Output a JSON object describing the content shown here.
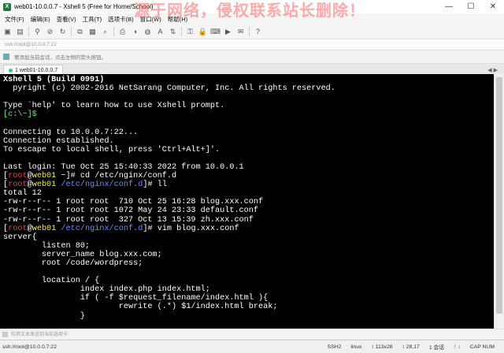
{
  "window": {
    "title": "web01-10.0.0.7 - Xshell 5 (Free for Home/School)",
    "watermark": "源于网络，侵权联系站长删除！",
    "controls": [
      "—",
      "☐",
      "✕"
    ]
  },
  "menu": [
    "文件(F)",
    "编辑(E)",
    "查看(V)",
    "工具(T)",
    "选项卡(B)",
    "窗口(W)",
    "帮助(H)"
  ],
  "address": {
    "value": "ssh://root@10.0.0.7:22"
  },
  "hint": "要添加当前会话，点击左侧的箭头按钮。",
  "tabs": [
    {
      "label": "1 web01-10.0.0.7"
    }
  ],
  "tab_nav": "◀ ▶",
  "terminal": {
    "lines": [
      [
        {
          "t": "Xshell 5 (Build 0991)",
          "c": "bold"
        }
      ],
      [
        {
          "t": "  pyright (c) 2002-2016 NetSarang Computer, Inc. All rights reserved."
        }
      ],
      [
        {
          "t": ""
        }
      ],
      [
        {
          "t": "Type `help' to learn how to use Xshell prompt."
        }
      ],
      [
        {
          "t": "[c:\\~]$",
          "c": "c-green"
        }
      ],
      [
        {
          "t": ""
        }
      ],
      [
        {
          "t": "Connecting to 10.0.0.7:22..."
        }
      ],
      [
        {
          "t": "Connection established."
        }
      ],
      [
        {
          "t": "To escape to local shell, press 'Ctrl+Alt+]'."
        }
      ],
      [
        {
          "t": ""
        }
      ],
      [
        {
          "t": "Last login: Tue Oct 25 15:40:33 2022 from 10.0.0.1"
        }
      ],
      [
        {
          "t": "["
        },
        {
          "t": "root",
          "c": "c-red"
        },
        {
          "t": "@"
        },
        {
          "t": "web01",
          "c": "c-yellow"
        },
        {
          "t": " ~]# cd /etc/nginx/conf.d"
        }
      ],
      [
        {
          "t": "["
        },
        {
          "t": "root",
          "c": "c-red"
        },
        {
          "t": "@"
        },
        {
          "t": "web01",
          "c": "c-yellow"
        },
        {
          "t": " "
        },
        {
          "t": "/etc/nginx/conf.d",
          "c": "c-blue"
        },
        {
          "t": "]# ll"
        }
      ],
      [
        {
          "t": "total 12"
        }
      ],
      [
        {
          "t": "-rw-r--r-- 1 root root  710 Oct 25 16:28 blog.xxx.conf"
        }
      ],
      [
        {
          "t": "-rw-r--r-- 1 root root 1072 May 24 23:33 default.conf"
        }
      ],
      [
        {
          "t": "-rw-r--r-- 1 root root  327 Oct 13 15:39 zh.xxx.conf"
        }
      ],
      [
        {
          "t": "["
        },
        {
          "t": "root",
          "c": "c-red"
        },
        {
          "t": "@"
        },
        {
          "t": "web01",
          "c": "c-yellow"
        },
        {
          "t": " "
        },
        {
          "t": "/etc/nginx/conf.d",
          "c": "c-blue"
        },
        {
          "t": "]# vim blog.xxx.conf"
        }
      ],
      [
        {
          "t": "server{"
        }
      ],
      [
        {
          "t": "        listen 80;"
        }
      ],
      [
        {
          "t": "        server_name blog.xxx.com;"
        }
      ],
      [
        {
          "t": "        root /code/wordpress;"
        }
      ],
      [
        {
          "t": ""
        }
      ],
      [
        {
          "t": "        location / {"
        }
      ],
      [
        {
          "t": "                index index.php index.html;"
        }
      ],
      [
        {
          "t": "                if ( -f $request_filename/index.html ){"
        }
      ],
      [
        {
          "t": "                        rewrite (.*) $1/index.html break;"
        }
      ],
      [
        {
          "t": "                }"
        }
      ]
    ]
  },
  "compose_hint": "仅将文本发送到当前选项卡",
  "status": {
    "left": "ssh://root@10.0.0.7:22",
    "items": [
      "SSH2",
      "linux",
      "↕ 113x28",
      "↕ 28,17",
      "1 会话",
      "↑ ↓",
      "CAP NUM"
    ]
  }
}
